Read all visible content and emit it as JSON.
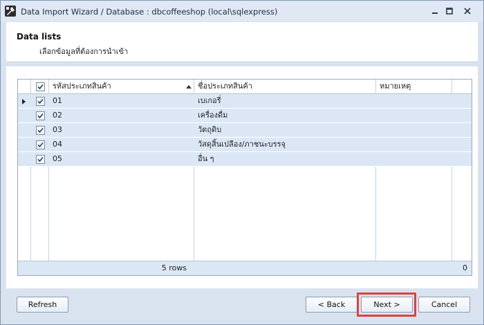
{
  "window": {
    "title": "Data Import Wizard / Database : dbcoffeeshop (local\\sqlexpress)"
  },
  "header": {
    "title": "Data lists",
    "subtitle": "เลือกข้อมูลที่ต้องการนำเข้า"
  },
  "grid": {
    "columns": [
      "รหัสประเภทสินค้า",
      "ชื่อประเภทสินค้า",
      "หมายเหตุ"
    ],
    "sort_column": "รหัสประเภทสินค้า",
    "select_all_checked": true,
    "rows": [
      {
        "code": "01",
        "name": "เบเกอรี่",
        "note": "",
        "checked": true,
        "current": true
      },
      {
        "code": "02",
        "name": "เครื่องดื่ม",
        "note": "",
        "checked": true,
        "current": false
      },
      {
        "code": "03",
        "name": "วัตถุดิบ",
        "note": "",
        "checked": true,
        "current": false
      },
      {
        "code": "04",
        "name": "วัสดุสิ้นเปลือง/ภาชนะบรรจุ",
        "note": "",
        "checked": true,
        "current": false
      },
      {
        "code": "05",
        "name": "อื่น ๆ",
        "note": "",
        "checked": true,
        "current": false
      }
    ],
    "footer": {
      "row_count": "5 rows",
      "right_value": "0"
    }
  },
  "buttons": {
    "refresh": "Refresh",
    "back": "< Back",
    "next": "Next >",
    "cancel": "Cancel"
  },
  "colors": {
    "highlight": "#e0413b",
    "row_background": "#dce7f5",
    "window_background": "#d9e3ef"
  },
  "icons": {
    "app": "wizard-tools-icon",
    "sort": "sort-ascending-icon",
    "row_pointer": "row-indicator-icon"
  }
}
